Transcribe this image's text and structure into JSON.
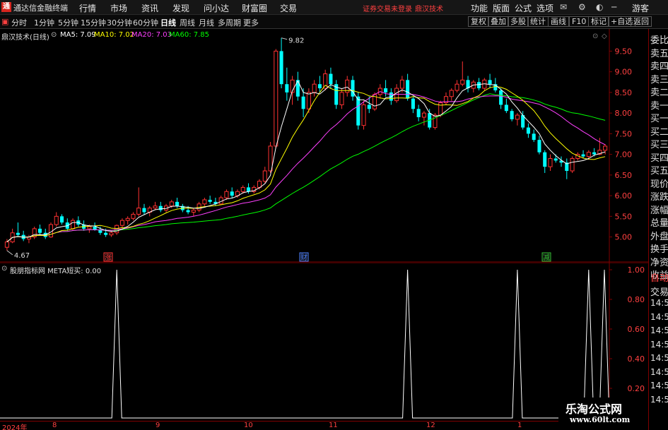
{
  "window": {
    "app_name": "通达信金融终端",
    "menu": [
      "行情",
      "市场",
      "资讯",
      "发现",
      "问小达",
      "财富圈",
      "交易"
    ],
    "notice": "证券交易未登录",
    "brand": "鼎汉技术",
    "right_menu": [
      "功能",
      "版面",
      "公式",
      "选项"
    ],
    "user": "游客"
  },
  "toolbar": {
    "periods": [
      "分时",
      "1分钟",
      "5分钟",
      "15分钟",
      "30分钟",
      "60分钟",
      "日线",
      "周线",
      "月线",
      "多周期",
      "更多"
    ],
    "active_period": "日线",
    "right_buttons": [
      "复权",
      "叠加",
      "多股",
      "统计",
      "画线",
      "F10",
      "标记",
      "+自选",
      "返回"
    ]
  },
  "main_chart": {
    "stock_label": "鼎汉技术(日线)",
    "ma_legend": [
      {
        "label": "MA5: 7.09",
        "color": "#ffffff"
      },
      {
        "label": "MA10: 7.02",
        "color": "#ffff00"
      },
      {
        "label": "MA20: 7.03",
        "color": "#ff40ff"
      },
      {
        "label": "MA60: 7.85",
        "color": "#00ff00"
      }
    ],
    "y_ticks": [
      "9.50",
      "9.00",
      "8.50",
      "8.00",
      "7.50",
      "7.00",
      "6.50",
      "6.00",
      "5.50",
      "5.00"
    ],
    "high_label": "9.82",
    "low_label": "4.67",
    "event_markers": [
      "涨",
      "财",
      "减"
    ]
  },
  "indicator": {
    "title": "股朋指标网 META短买: 0.00",
    "y_ticks": [
      "1.00",
      "0.80",
      "0.60",
      "0.40",
      "0.20"
    ]
  },
  "date_axis": [
    "2024年",
    "8",
    "9",
    "10",
    "11",
    "12",
    "1"
  ],
  "right_panel": {
    "items": [
      "委比",
      "卖五",
      "卖四",
      "卖三",
      "卖二",
      "卖一",
      "买一",
      "买二",
      "买三",
      "买四",
      "买五",
      "现价",
      "涨跌",
      "涨幅",
      "总量",
      "外盘",
      "换手",
      "净资",
      "收益"
    ],
    "lower_items": [
      "自动",
      "交易",
      "14:56",
      "14:56",
      "14:56",
      "14:56",
      "14:56",
      "14:56",
      "14:56",
      "14:56"
    ]
  },
  "watermark": {
    "line1": "乐淘公式网",
    "line2": "www.60lt.com"
  },
  "colors": {
    "up": "#ff3232",
    "down": "#00ffff",
    "ma5": "#ffffff",
    "ma10": "#ffff00",
    "ma20": "#ff40ff",
    "ma60": "#00ff00",
    "axis": "#800000",
    "indicator": "#ffffff"
  },
  "chart_data": {
    "type": "candlestick",
    "ylim": [
      4.6,
      9.9
    ],
    "candles": [
      [
        4.75,
        4.95,
        4.67,
        4.88
      ],
      [
        4.88,
        5.2,
        4.85,
        5.1
      ],
      [
        5.1,
        5.35,
        5.0,
        5.05
      ],
      [
        5.05,
        5.15,
        4.9,
        4.95
      ],
      [
        4.95,
        5.05,
        4.85,
        5.0
      ],
      [
        5.0,
        5.25,
        4.95,
        5.2
      ],
      [
        5.2,
        5.3,
        5.05,
        5.1
      ],
      [
        5.1,
        5.2,
        4.95,
        5.0
      ],
      [
        5.0,
        5.35,
        4.98,
        5.3
      ],
      [
        5.3,
        5.6,
        5.25,
        5.5
      ],
      [
        5.5,
        5.55,
        5.3,
        5.35
      ],
      [
        5.35,
        5.45,
        5.15,
        5.2
      ],
      [
        5.2,
        5.45,
        5.15,
        5.4
      ],
      [
        5.4,
        5.5,
        5.25,
        5.3
      ],
      [
        5.3,
        5.4,
        5.15,
        5.2
      ],
      [
        5.2,
        5.3,
        5.1,
        5.25
      ],
      [
        5.25,
        5.35,
        5.15,
        5.18
      ],
      [
        5.18,
        5.25,
        5.05,
        5.1
      ],
      [
        5.1,
        5.2,
        5.0,
        5.05
      ],
      [
        5.05,
        5.15,
        5.0,
        5.1
      ],
      [
        5.1,
        5.3,
        5.05,
        5.28
      ],
      [
        5.28,
        5.45,
        5.2,
        5.4
      ],
      [
        5.4,
        5.5,
        5.3,
        5.45
      ],
      [
        5.45,
        5.6,
        5.4,
        5.55
      ],
      [
        5.55,
        6.2,
        5.5,
        5.7
      ],
      [
        5.7,
        5.8,
        5.55,
        5.6
      ],
      [
        5.6,
        5.75,
        5.5,
        5.7
      ],
      [
        5.7,
        5.85,
        5.65,
        5.75
      ],
      [
        5.75,
        5.85,
        5.6,
        5.65
      ],
      [
        5.65,
        5.8,
        5.6,
        5.75
      ],
      [
        5.75,
        5.9,
        5.7,
        5.85
      ],
      [
        5.85,
        5.95,
        5.7,
        5.75
      ],
      [
        5.75,
        5.8,
        5.6,
        5.65
      ],
      [
        5.65,
        5.75,
        5.55,
        5.6
      ],
      [
        5.6,
        5.7,
        5.5,
        5.65
      ],
      [
        5.65,
        5.85,
        5.6,
        5.8
      ],
      [
        5.8,
        5.95,
        5.75,
        5.9
      ],
      [
        5.9,
        6.0,
        5.8,
        5.85
      ],
      [
        5.85,
        5.95,
        5.75,
        5.8
      ],
      [
        5.8,
        6.0,
        5.78,
        5.95
      ],
      [
        5.95,
        6.15,
        5.9,
        6.1
      ],
      [
        6.1,
        6.2,
        5.95,
        6.0
      ],
      [
        6.0,
        6.15,
        5.95,
        6.1
      ],
      [
        6.1,
        6.25,
        6.05,
        6.2
      ],
      [
        6.2,
        6.3,
        6.05,
        6.1
      ],
      [
        6.1,
        6.25,
        6.05,
        6.2
      ],
      [
        6.2,
        6.4,
        6.15,
        6.35
      ],
      [
        6.35,
        6.7,
        6.3,
        6.6
      ],
      [
        6.6,
        7.3,
        6.55,
        7.2
      ],
      [
        7.2,
        9.55,
        7.15,
        9.5
      ],
      [
        9.5,
        9.82,
        8.6,
        8.7
      ],
      [
        8.7,
        9.1,
        8.3,
        8.5
      ],
      [
        8.5,
        8.9,
        8.2,
        8.8
      ],
      [
        8.8,
        9.0,
        8.3,
        8.4
      ],
      [
        8.4,
        8.6,
        7.9,
        8.1
      ],
      [
        8.1,
        8.6,
        8.0,
        8.5
      ],
      [
        8.5,
        8.8,
        8.4,
        8.7
      ],
      [
        8.7,
        8.9,
        8.5,
        8.6
      ],
      [
        8.6,
        9.05,
        8.55,
        8.95
      ],
      [
        8.95,
        9.1,
        8.6,
        8.7
      ],
      [
        8.7,
        8.8,
        8.1,
        8.2
      ],
      [
        8.2,
        8.6,
        8.1,
        8.5
      ],
      [
        8.5,
        8.9,
        8.4,
        8.8
      ],
      [
        8.8,
        8.9,
        8.3,
        8.4
      ],
      [
        8.4,
        8.5,
        7.6,
        7.7
      ],
      [
        7.7,
        8.3,
        7.6,
        8.2
      ],
      [
        8.2,
        8.4,
        8.0,
        8.1
      ],
      [
        8.1,
        8.5,
        8.05,
        8.45
      ],
      [
        8.45,
        8.7,
        8.35,
        8.6
      ],
      [
        8.6,
        8.8,
        8.4,
        8.5
      ],
      [
        8.5,
        8.6,
        8.2,
        8.3
      ],
      [
        8.3,
        8.7,
        8.25,
        8.6
      ],
      [
        8.6,
        8.9,
        8.5,
        8.8
      ],
      [
        8.8,
        8.95,
        8.3,
        8.35
      ],
      [
        8.35,
        8.4,
        8.0,
        8.1
      ],
      [
        8.1,
        8.2,
        7.8,
        7.9
      ],
      [
        7.9,
        8.05,
        7.7,
        8.0
      ],
      [
        8.0,
        8.1,
        7.6,
        7.65
      ],
      [
        7.65,
        8.0,
        7.6,
        7.95
      ],
      [
        7.95,
        8.3,
        7.9,
        8.25
      ],
      [
        8.25,
        8.5,
        8.2,
        8.4
      ],
      [
        8.4,
        8.6,
        8.3,
        8.55
      ],
      [
        8.55,
        8.8,
        8.5,
        8.7
      ],
      [
        8.7,
        9.25,
        8.65,
        8.8
      ],
      [
        8.8,
        8.9,
        8.5,
        8.6
      ],
      [
        8.6,
        8.8,
        8.5,
        8.75
      ],
      [
        8.75,
        8.85,
        8.55,
        8.6
      ],
      [
        8.6,
        8.85,
        8.55,
        8.8
      ],
      [
        8.8,
        8.95,
        8.6,
        8.7
      ],
      [
        8.7,
        8.85,
        8.5,
        8.55
      ],
      [
        8.55,
        8.6,
        8.1,
        8.2
      ],
      [
        8.2,
        8.35,
        8.0,
        8.05
      ],
      [
        8.05,
        8.1,
        7.8,
        7.85
      ],
      [
        7.85,
        8.0,
        7.7,
        7.95
      ],
      [
        7.95,
        8.05,
        7.6,
        7.65
      ],
      [
        7.65,
        7.75,
        7.4,
        7.5
      ],
      [
        7.5,
        7.6,
        7.3,
        7.35
      ],
      [
        7.35,
        7.45,
        7.0,
        7.05
      ],
      [
        7.05,
        7.1,
        6.55,
        6.7
      ],
      [
        6.7,
        7.0,
        6.6,
        6.9
      ],
      [
        6.9,
        7.0,
        6.8,
        6.85
      ],
      [
        6.85,
        6.95,
        6.7,
        6.8
      ],
      [
        6.8,
        6.9,
        6.4,
        6.6
      ],
      [
        6.6,
        6.95,
        6.55,
        6.9
      ],
      [
        6.9,
        7.05,
        6.85,
        7.0
      ],
      [
        7.0,
        7.1,
        6.9,
        6.95
      ],
      [
        6.95,
        7.1,
        6.9,
        7.05
      ],
      [
        7.05,
        7.15,
        6.95,
        7.0
      ],
      [
        7.0,
        7.4,
        6.98,
        7.1
      ],
      [
        7.1,
        7.25,
        7.0,
        7.2
      ]
    ],
    "signals": [
      0.0,
      0.0,
      1.0,
      0.0,
      1.0,
      1.0,
      0.0,
      1.0,
      1.0,
      1.0
    ]
  }
}
